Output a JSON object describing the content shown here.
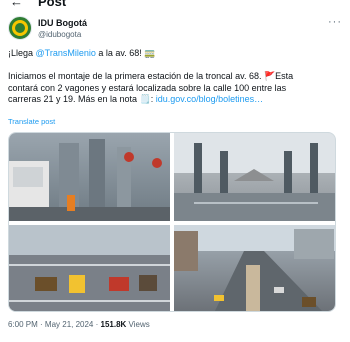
{
  "header": {
    "back_label": "←",
    "title": "Post"
  },
  "author": {
    "name": "IDU Bogotá",
    "handle": "@idubogota",
    "more_label": "···"
  },
  "tweet": {
    "l1_a": "¡Llega ",
    "l1_link": "@TransMilenio",
    "l1_b": " a la av. 68! 🚃",
    "l2": "Iniciamos el montaje de la primera estación de la troncal av. 68. 🚩Esta",
    "l3": "contará con 2 vagones y estará localizada sobre la calle 100 entre las",
    "l4_a": "carreras 21 y 19. Más en la nota 🗒️: ",
    "l4_link": "idu.gov.co/blog/boletines…",
    "translate": "Translate post"
  },
  "meta": {
    "time": "6:00 PM · May 21, 2024 · ",
    "views": "151.8K",
    "views_label": " Views"
  }
}
